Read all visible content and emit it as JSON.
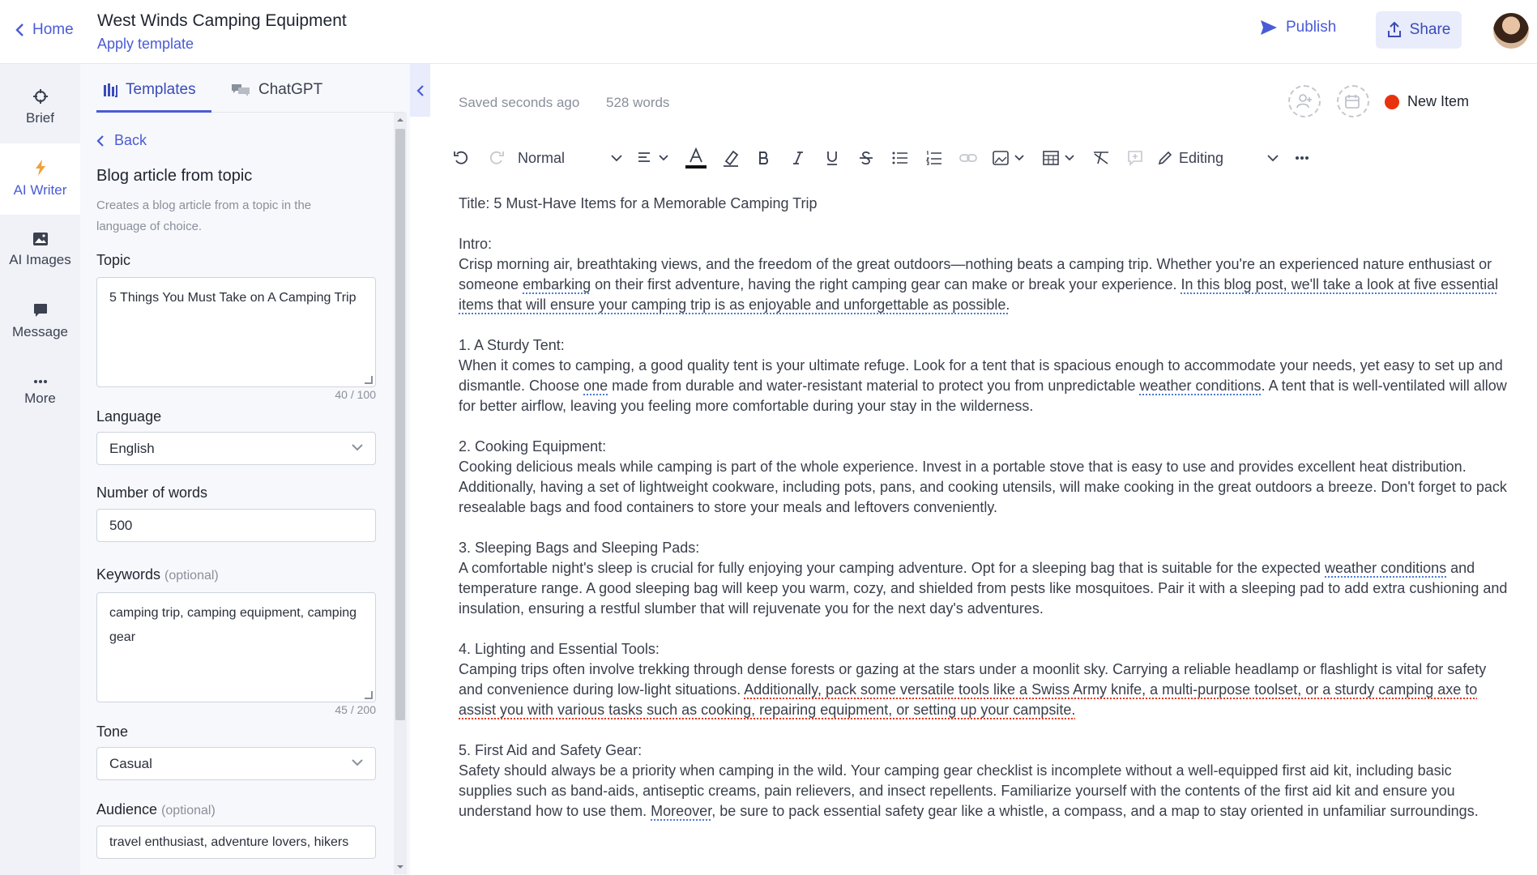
{
  "header": {
    "home_label": "Home",
    "doc_title": "West Winds Camping Equipment",
    "apply_template": "Apply template",
    "publish_label": "Publish",
    "share_label": "Share"
  },
  "rail": {
    "items": [
      {
        "label": "Brief",
        "icon": "target-icon"
      },
      {
        "label": "AI Writer",
        "icon": "lightning-icon"
      },
      {
        "label": "AI Images",
        "icon": "image-icon"
      },
      {
        "label": "Message",
        "icon": "chat-icon"
      },
      {
        "label": "More",
        "icon": "more-icon"
      }
    ]
  },
  "panel": {
    "tabs": [
      {
        "label": "Templates",
        "icon": "templates-icon"
      },
      {
        "label": "ChatGPT",
        "icon": "chat-bubbles-icon"
      }
    ],
    "back_label": "Back",
    "template_title": "Blog article from topic",
    "template_desc": "Creates a blog article from a topic in the language of choice.",
    "fields": {
      "topic_label": "Topic",
      "topic_value": "5 Things You Must Take on A Camping Trip",
      "topic_counter": "40 / 100",
      "language_label": "Language",
      "language_value": "English",
      "words_label": "Number of words",
      "words_value": "500",
      "keywords_label": "Keywords",
      "keywords_optional": "(optional)",
      "keywords_value": "camping trip, camping equipment, camping gear",
      "keywords_counter": "45 / 200",
      "tone_label": "Tone",
      "tone_value": "Casual",
      "audience_label": "Audience",
      "audience_optional": "(optional)",
      "audience_value": "travel enthusiast, adventure lovers, hikers"
    }
  },
  "editor": {
    "saved_status": "Saved seconds ago",
    "word_count": "528 words",
    "new_item_label": "New Item",
    "style_select": "Normal",
    "mode_label": "Editing",
    "content": {
      "title": "Title: 5 Must-Have Items for a Memorable Camping Trip",
      "intro_heading": "Intro:",
      "intro_a": "Crisp morning air, breathtaking views, and the freedom of the great outdoors—nothing beats a camping trip. Whether you're an experienced nature enthusiast or someone ",
      "intro_u1": "embarking",
      "intro_b": " on their first adventure, having the right camping gear can make or break your experience. ",
      "intro_u2": "In this blog post, we'll take a look at five essential items that will ensure your camping trip is as enjoyable and unforgettable as possible.",
      "s1_heading": "1. A Sturdy Tent:",
      "s1_a": "When it comes to camping, a good quality tent is your ultimate refuge. Look for a tent that is spacious enough to accommodate your needs, yet easy to set up and dismantle. Choose ",
      "s1_u1": "one",
      "s1_b": " made from durable and water-resistant material to protect you from unpredictable ",
      "s1_u2": "weather conditions",
      "s1_c": ". A tent that is well-ventilated will allow for better airflow, leaving you feeling more comfortable during your stay in the wilderness.",
      "s2_heading": "2. Cooking Equipment:",
      "s2_text": "Cooking delicious meals while camping is part of the whole experience. Invest in a portable stove that is easy to use and provides excellent heat distribution. Additionally, having a set of lightweight cookware, including pots, pans, and cooking utensils, will make cooking in the great outdoors a breeze. Don't forget to pack resealable bags and food containers to store your meals and leftovers conveniently.",
      "s3_heading": "3. Sleeping Bags and Sleeping Pads:",
      "s3_a": "A comfortable night's sleep is crucial for fully enjoying your camping adventure. Opt for a sleeping bag that is suitable for the expected ",
      "s3_u1": "weather conditions",
      "s3_b": " and temperature range. A good sleeping bag will keep you warm, cozy, and shielded from pests like mosquitoes. Pair it with a sleeping pad to add extra cushioning and insulation, ensuring a restful slumber that will rejuvenate you for the next day's adventures.",
      "s4_heading": "4. Lighting and Essential Tools:",
      "s4_a": "Camping trips often involve trekking through dense forests or gazing at the stars under a moonlit sky. Carrying a reliable headlamp or flashlight is vital for safety and convenience during low-light situations. ",
      "s4_u1": "Additionally, pack some versatile tools like a Swiss Army knife, a multi-purpose toolset, or a sturdy camping axe to assist you with various tasks such as cooking, repairing equipment, or setting up your campsite.",
      "s5_heading": "5. First Aid and Safety Gear:",
      "s5_a": "Safety should always be a priority when camping in the wild. Your camping gear checklist is incomplete without a well-equipped first aid kit, including basic supplies such as band-aids, antiseptic creams, pain relievers, and insect repellents. Familiarize yourself with the contents of the first aid kit and ensure you understand how to use them. ",
      "s5_u1": "Moreover",
      "s5_b": ", be sure to pack essential safety gear like a whistle, a compass, and a map to stay oriented in unfamiliar surroundings."
    }
  },
  "colors": {
    "accent": "#4a5bd6",
    "new_item_dot": "#e8320d"
  }
}
